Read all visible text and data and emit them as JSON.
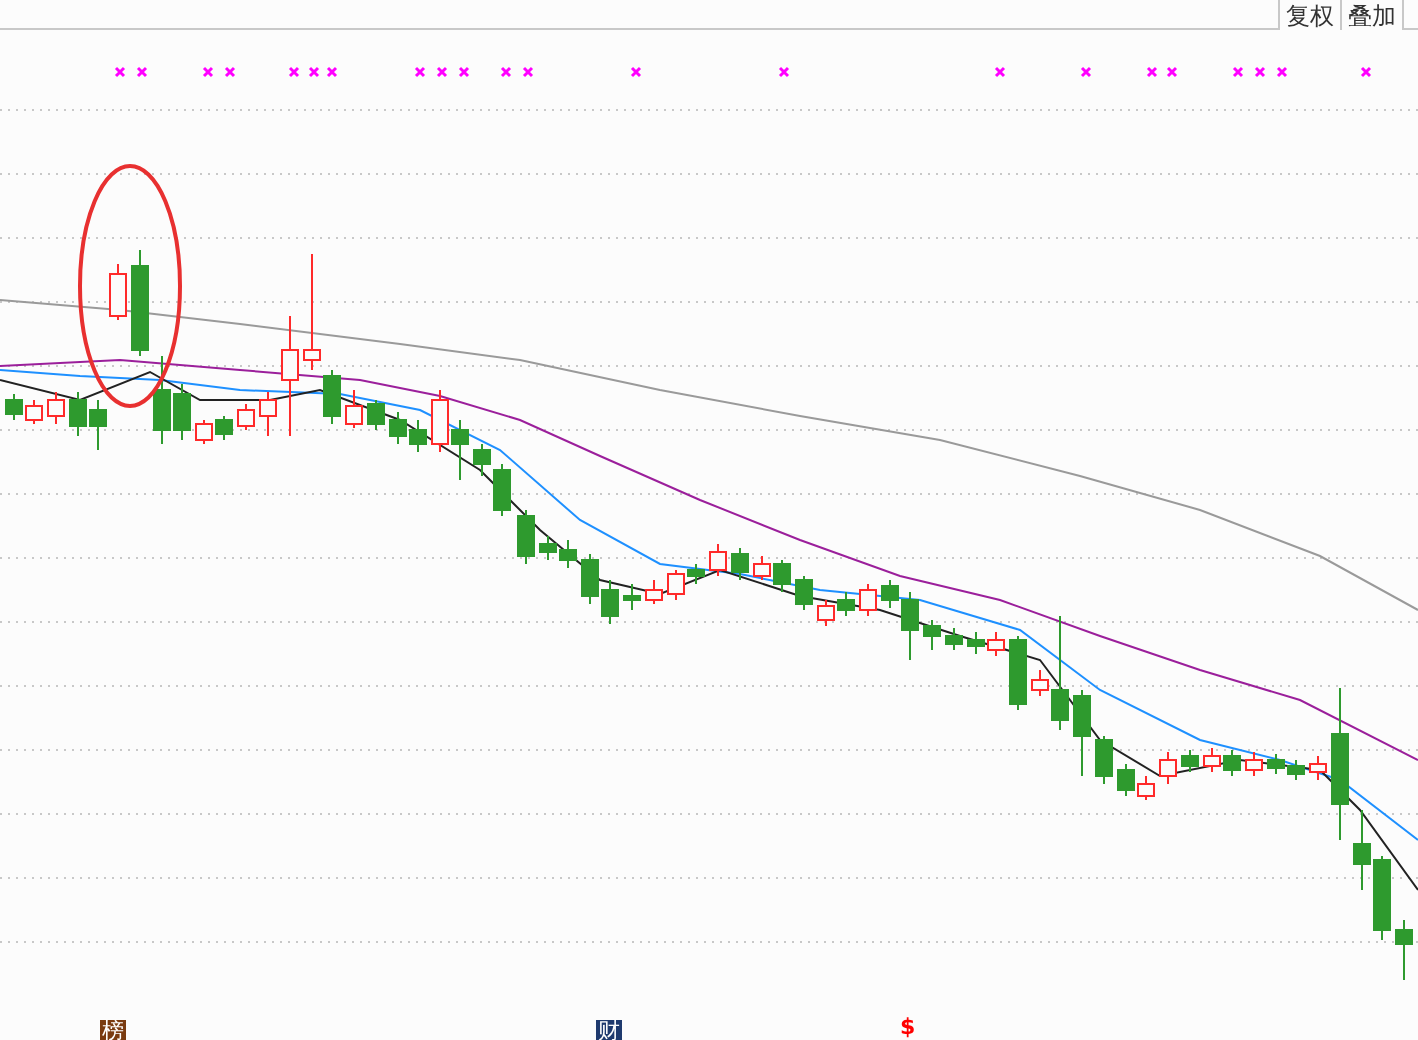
{
  "toolbar": {
    "buttons": [
      {
        "label": "复权"
      },
      {
        "label": "叠加"
      }
    ]
  },
  "bottom_markers": [
    {
      "kind": "badge",
      "label": "榜",
      "color": "#7a3b10"
    },
    {
      "kind": "badge",
      "label": "财",
      "color": "#1f3a6e"
    },
    {
      "kind": "plain",
      "label": "$",
      "color": "#ff0000"
    }
  ]
}
